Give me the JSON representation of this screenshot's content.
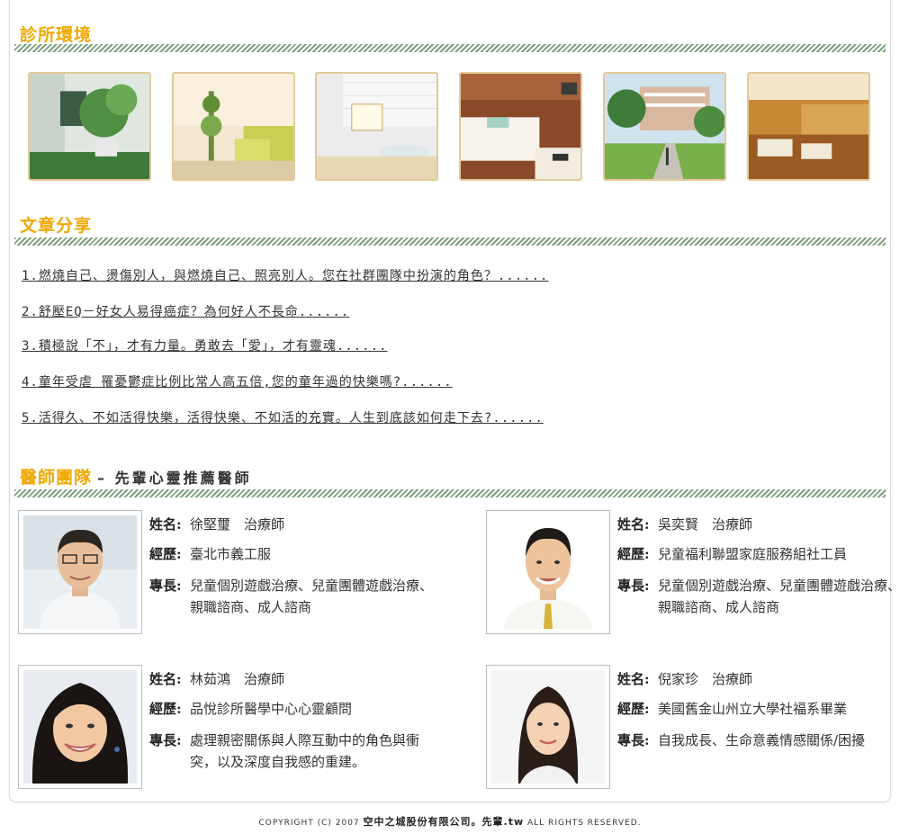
{
  "clinic": {
    "title": "診所環境"
  },
  "articles": {
    "title": "文章分享",
    "items": [
      "1.燃燒自己、燙傷別人，與燃燒自己、照亮別人。您在社群團隊中扮演的角色？......",
      "2.舒壓EQ－好女人易得癌症？為何好人不長命......",
      "3.積極說「不」，才有力量。勇敢去「愛」，才有靈魂......",
      "4.童年受虐 罹憂鬱症比例比常人高五倍,您的童年過的快樂嗎?......",
      "5.活得久、不如活得快樂，活得快樂、不如活的充實。人生到底該如何走下去?......"
    ]
  },
  "team": {
    "title": "醫師團隊",
    "subtitle": "– 先輩心靈推薦醫師",
    "labels": {
      "name": "姓名:",
      "experience": "經歷:",
      "specialty": "專長:"
    },
    "doctors": [
      {
        "name": "徐堅璽　治療師",
        "experience": "臺北市義工服",
        "specialty": "兒童個別遊戲治療、兒童團體遊戲治療、親職諮商、成人諮商"
      },
      {
        "name": "吳奕賢　治療師",
        "experience": "兒童福利聯盟家庭服務組社工員",
        "specialty": "兒童個別遊戲治療、兒童團體遊戲治療、親職諮商、成人諮商"
      },
      {
        "name": "林茹鴻　治療師",
        "experience": "品悅診所醫學中心心靈顧問",
        "specialty": "處理親密關係與人際互動中的角色與衝突，以及深度自我感的重建。"
      },
      {
        "name": "倪家珍　治療師",
        "experience": "美國舊金山州立大學社福系畢業",
        "specialty": "自我成長、生命意義情感關係/困擾"
      }
    ]
  },
  "footer": {
    "prefix": "COPYRIGHT (C) 2007",
    "company": "空中之城股份有限公司。先輩.tw",
    "suffix": "ALL RIGHTS RESERVED."
  }
}
